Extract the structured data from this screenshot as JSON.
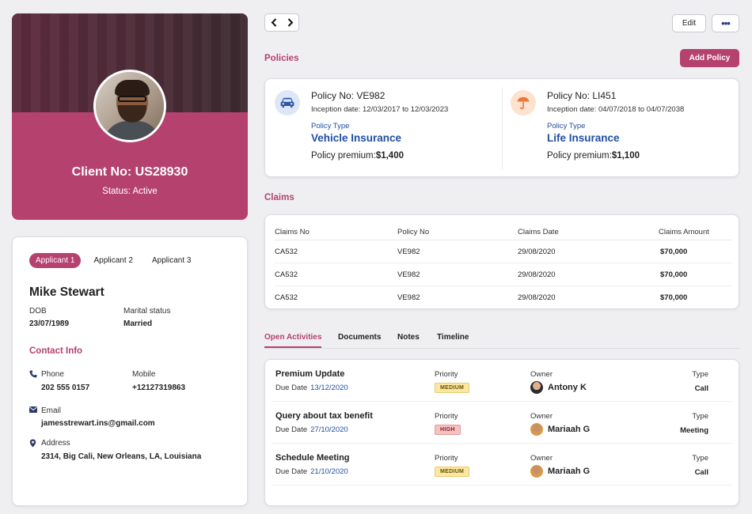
{
  "profile": {
    "client_no": "Client No: US28930",
    "status": "Status: Active"
  },
  "applicant": {
    "tabs": [
      "Applicant 1",
      "Applicant 2",
      "Applicant 3"
    ],
    "name": "Mike Stewart",
    "dob_label": "DOB",
    "dob": "23/07/1989",
    "marital_label": "Marital status",
    "marital": "Married",
    "contact_title": "Contact Info",
    "phone_label": "Phone",
    "phone": "202 555 0157",
    "mobile_label": "Mobile",
    "mobile": "+12127319863",
    "email_label": "Email",
    "email": "jamesstrewart.ins@gmail.com",
    "address_label": "Address",
    "address": "2314, Big Cali, New Orleans, LA, Louisiana"
  },
  "toolbar": {
    "prev_icon": "chevron-left",
    "next_icon": "chevron-right",
    "edit_label": "Edit",
    "more_icon": "•••"
  },
  "policies": {
    "title": "Policies",
    "add_label": "Add Policy",
    "items": [
      {
        "no": "Policy No: VE982",
        "inception": "Inception date: 12/03/2017 to 12/03/2023",
        "type_label": "Policy Type",
        "type": "Vehicle Insurance",
        "premium_label": "Policy premium:",
        "premium": "$1,400",
        "icon": "car-icon"
      },
      {
        "no": "Policy No: LI451",
        "inception": "Inception date: 04/07/2018 to 04/07/2038",
        "type_label": "Policy Type",
        "type": "Life Insurance",
        "premium_label": "Policy premium:",
        "premium": "$1,100",
        "icon": "umbrella-icon"
      }
    ]
  },
  "claims": {
    "title": "Claims",
    "headers": [
      "Claims No",
      "Policy No",
      "Claims Date",
      "Claims Amount"
    ],
    "rows": [
      [
        "CA532",
        "VE982",
        "29/08/2020",
        "$70,000"
      ],
      [
        "CA532",
        "VE982",
        "29/08/2020",
        "$70,000"
      ],
      [
        "CA532",
        "VE982",
        "29/08/2020",
        "$70,000"
      ]
    ]
  },
  "activity_tabs": [
    "Open Activities",
    "Documents",
    "Notes",
    "Timeline"
  ],
  "activities": {
    "due_label": "Due Date",
    "priority_label": "Priority",
    "owner_label": "Owner",
    "type_label": "Type",
    "items": [
      {
        "title": "Premium Update",
        "due": "13/12/2020",
        "priority": "MEDIUM",
        "owner": "Antony K",
        "type": "Call"
      },
      {
        "title": "Query about tax benefit",
        "due": "27/10/2020",
        "priority": "HIGH",
        "owner": "Mariaah G",
        "type": "Meeting"
      },
      {
        "title": "Schedule Meeting",
        "due": "21/10/2020",
        "priority": "MEDIUM",
        "owner": "Mariaah G",
        "type": "Call"
      }
    ]
  },
  "colors": {
    "accent": "#b5416f",
    "link": "#1f4fa0"
  }
}
